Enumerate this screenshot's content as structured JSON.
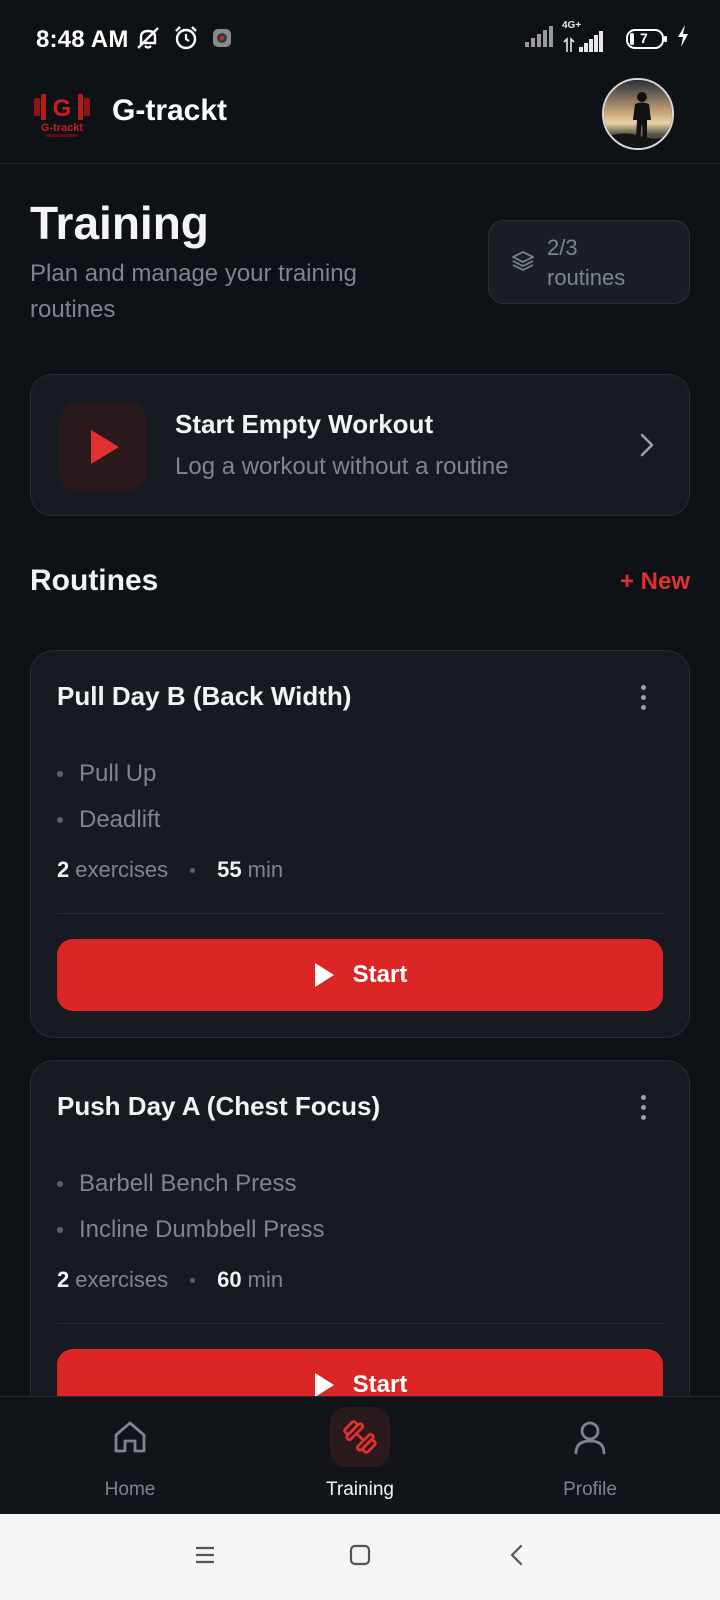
{
  "status_bar": {
    "time": "8:48 AM",
    "network_label": "4G+",
    "battery_level": "7",
    "icons": [
      "muted-bell-icon",
      "alarm-icon",
      "notification-app-icon",
      "signal-icon",
      "signal-4g-icon",
      "battery-icon",
      "charging-icon"
    ]
  },
  "header": {
    "app_title": "G-trackt",
    "logo_text": "G-trackt"
  },
  "page": {
    "title": "Training",
    "subtitle": "Plan and manage your training routines",
    "badge_count": "2/3",
    "badge_label": "routines"
  },
  "empty_workout": {
    "title": "Start Empty Workout",
    "subtitle": "Log a workout without a routine"
  },
  "routines_section": {
    "title": "Routines",
    "new_label": "+ New"
  },
  "routines": [
    {
      "name": "Pull Day B (Back Width)",
      "exercises": [
        "Pull Up",
        "Deadlift"
      ],
      "exercise_count": "2",
      "exercise_unit": "exercises",
      "duration": "55",
      "duration_unit": "min",
      "start_label": "Start"
    },
    {
      "name": "Push Day A (Chest Focus)",
      "exercises": [
        "Barbell Bench Press",
        "Incline Dumbbell Press"
      ],
      "exercise_count": "2",
      "exercise_unit": "exercises",
      "duration": "60",
      "duration_unit": "min",
      "start_label": "Start"
    }
  ],
  "bottom_nav": {
    "items": [
      {
        "label": "Home",
        "icon": "home-icon"
      },
      {
        "label": "Training",
        "icon": "dumbbell-icon",
        "active": true
      },
      {
        "label": "Profile",
        "icon": "user-icon"
      }
    ]
  },
  "colors": {
    "background": "#0e1116",
    "card": "#171b21",
    "accent": "#dc2626",
    "muted_text": "#7c8594"
  }
}
